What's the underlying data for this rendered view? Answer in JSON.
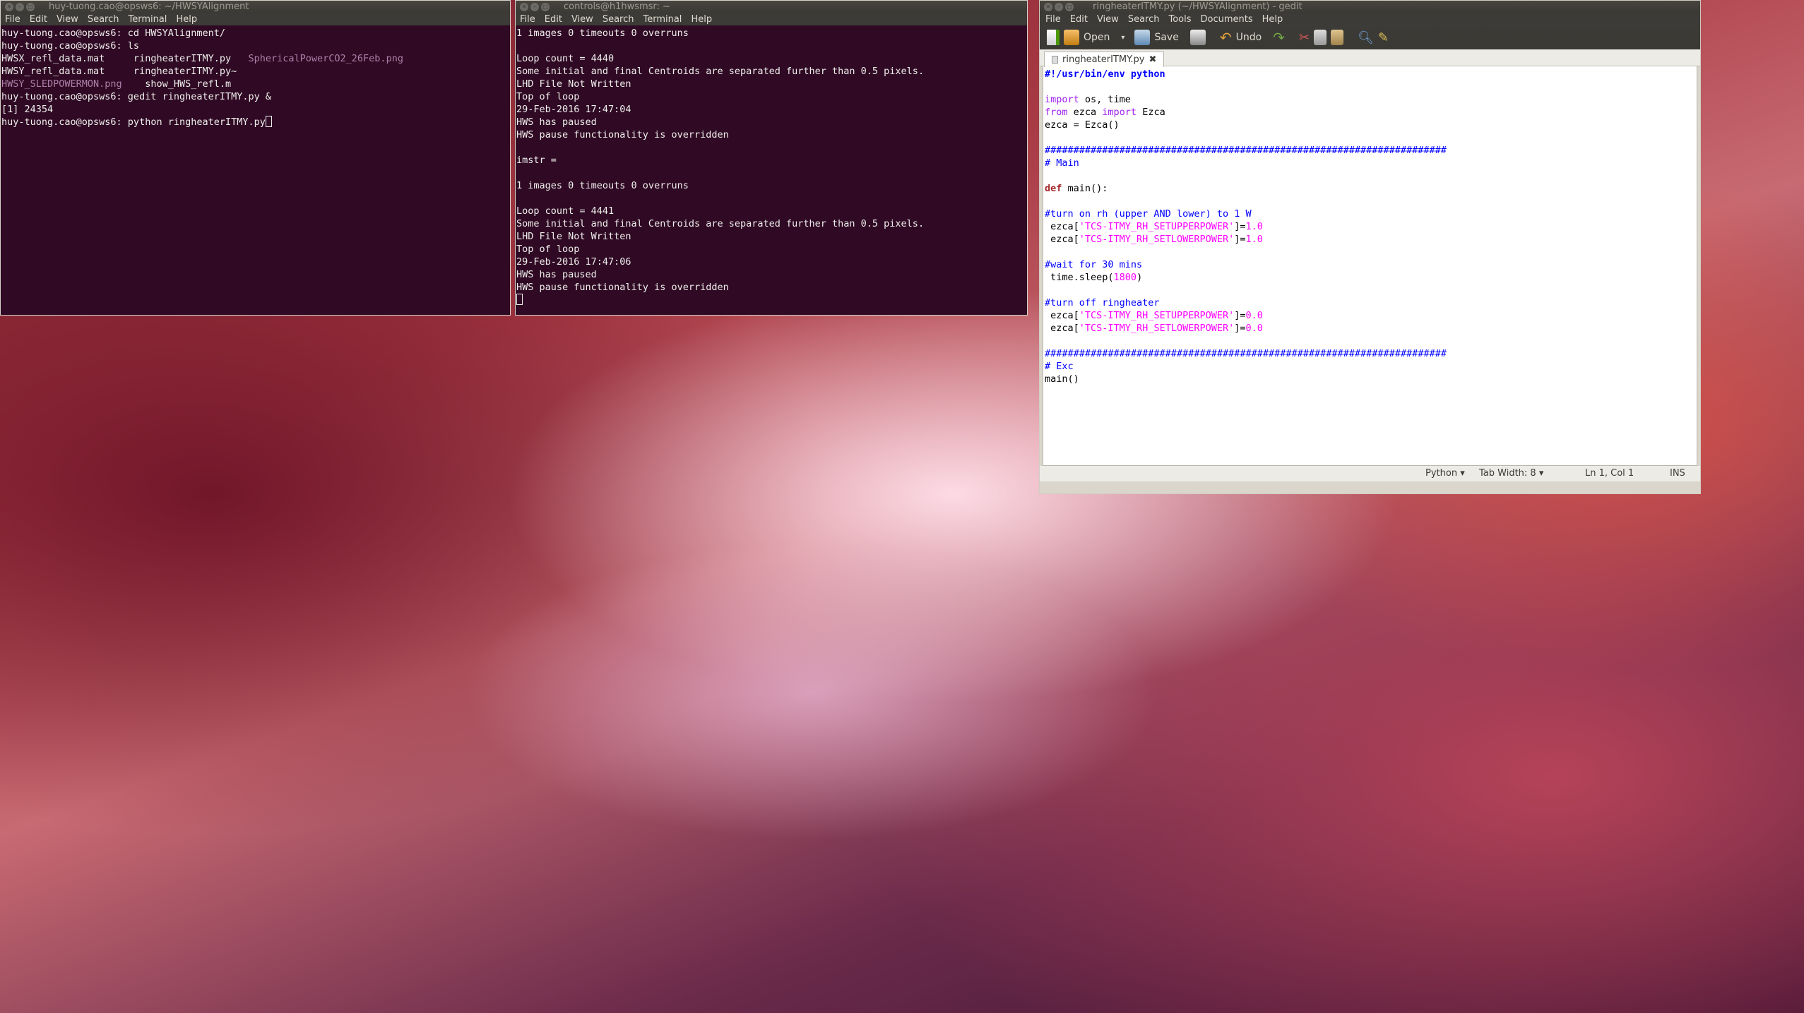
{
  "term1": {
    "title": "huy-tuong.cao@opsws6: ~/HWSYAlignment",
    "menu": [
      "File",
      "Edit",
      "View",
      "Search",
      "Terminal",
      "Help"
    ],
    "lines": [
      "huy-tuong.cao@opsws6: cd HWSYAlignment/",
      "huy-tuong.cao@opsws6: ls",
      "HWSX_refl_data.mat     ringheaterITMY.py   ",
      "HWSY_refl_data.mat     ringheaterITMY.py~",
      "    show_HWS_refl.m",
      "huy-tuong.cao@opsws6: gedit ringheaterITMY.py &",
      "[1] 24354",
      "huy-tuong.cao@opsws6: python ringheaterITMY.py"
    ],
    "purple_file_1": "SphericalPowerCO2_26Feb.png",
    "purple_file_2": "HWSY_SLEDPOWERMON.png"
  },
  "term2": {
    "title": "controls@h1hwsmsr: ~",
    "menu": [
      "File",
      "Edit",
      "View",
      "Search",
      "Terminal",
      "Help"
    ],
    "lines": [
      "1 images 0 timeouts 0 overruns",
      "",
      "Loop count = 4440",
      "Some initial and final Centroids are separated further than 0.5 pixels.",
      "LHD File Not Written",
      "Top of loop",
      "29-Feb-2016 17:47:04",
      "HWS has paused",
      "HWS pause functionality is overridden",
      "",
      "imstr =",
      "",
      "1 images 0 timeouts 0 overruns",
      "",
      "Loop count = 4441",
      "Some initial and final Centroids are separated further than 0.5 pixels.",
      "LHD File Not Written",
      "Top of loop",
      "29-Feb-2016 17:47:06",
      "HWS has paused",
      "HWS pause functionality is overridden"
    ]
  },
  "gedit": {
    "title": "ringheaterITMY.py (~/HWSYAlignment) - gedit",
    "menu": [
      "File",
      "Edit",
      "View",
      "Search",
      "Tools",
      "Documents",
      "Help"
    ],
    "toolbar": {
      "open": "Open",
      "save": "Save",
      "undo": "Undo"
    },
    "tab_label": "ringheaterITMY.py",
    "code": {
      "shebang": "#!/usr/bin/env python",
      "import_kw": "import",
      "import_rest": " os, time",
      "from_kw": "from",
      "from_mid": " ezca ",
      "from_import_kw": "import",
      "from_rest": " Ezca",
      "ezca_assign": "ezca = Ezca()",
      "hashes": "######################################################################",
      "main_comment": "# Main",
      "def_kw": "def",
      "def_rest": " main():",
      "c_turn_on": "#turn on rh (upper AND lower) to 1 W",
      "ezca_prefix": " ezca[",
      "s_upper": "'TCS-ITMY_RH_SETUPPERPOWER'",
      "s_lower": "'TCS-ITMY_RH_SETLOWERPOWER'",
      "eq_close": "]=",
      "v_on": "1.0",
      "c_wait": "#wait for 30 mins",
      "sleep_pre": " time.sleep(",
      "sleep_val": "1800",
      "sleep_post": ")",
      "c_turn_off": "#turn off ringheater",
      "v_off": "0.0",
      "exc_comment": "# Exc",
      "main_call": "main()"
    },
    "status": {
      "language": "Python ▾",
      "tab_width": "Tab Width: 8 ▾",
      "position": "Ln 1, Col 1",
      "mode": "INS"
    }
  }
}
